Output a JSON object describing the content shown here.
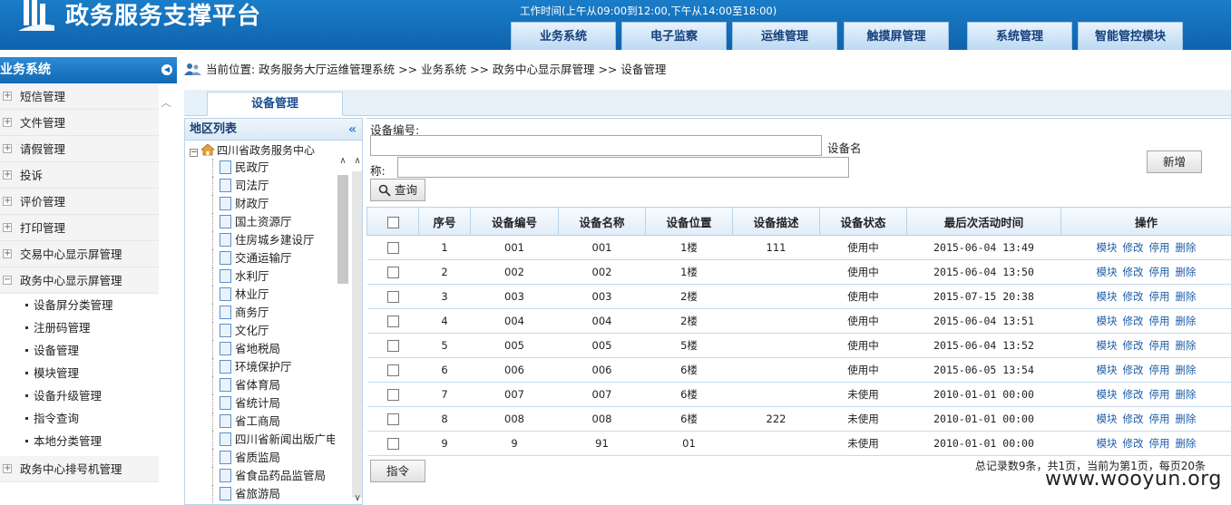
{
  "header": {
    "title": "政务服务支撑平台",
    "work_time": "工作时间(上午从09:00到12:00,下午从14:00至18:00)",
    "nav_tabs": [
      "业务系统",
      "电子监察",
      "运维管理",
      "触摸屏管理",
      "系统管理",
      "智能管控模块"
    ],
    "colors": {
      "header_bg": "#1269b5",
      "accent": "#1d5ea8"
    }
  },
  "sidebar": {
    "title": "业务系统",
    "items": [
      "短信管理",
      "文件管理",
      "请假管理",
      "投诉",
      "评价管理",
      "打印管理",
      "交易中心显示屏管理",
      "政务中心显示屏管理"
    ],
    "sub_items": [
      "设备屏分类管理",
      "注册码管理",
      "设备管理",
      "模块管理",
      "设备升级管理",
      "指令查询",
      "本地分类管理"
    ],
    "last_item": "政务中心排号机管理"
  },
  "breadcrumb": {
    "text": "当前位置: 政务服务大厅运维管理系统 >> 业务系统 >> 政务中心显示屏管理 >> 设备管理"
  },
  "content_tab": "设备管理",
  "region": {
    "title": "地区列表",
    "root": "四川省政务服务中心",
    "nodes": [
      "民政厅",
      "司法厅",
      "财政厅",
      "国土资源厅",
      "住房城乡建设厅",
      "交通运输厅",
      "水利厅",
      "林业厅",
      "商务厅",
      "文化厅",
      "省地税局",
      "环境保护厅",
      "省体育局",
      "省统计局",
      "省工商局",
      "四川省新闻出版广电",
      "省质监局",
      "省食品药品监管局",
      "省旅游局"
    ]
  },
  "form": {
    "device_no_label": "设备编号:",
    "device_no_value": "",
    "device_name_label_1": "设备名",
    "device_name_label_2": "称:",
    "device_name_value": "",
    "query_button": "查询",
    "add_button": "新增"
  },
  "table": {
    "headers": [
      "序号",
      "设备编号",
      "设备名称",
      "设备位置",
      "设备描述",
      "设备状态",
      "最后次活动时间",
      "操作"
    ],
    "actions": [
      "模块",
      "修改",
      "停用",
      "删除"
    ],
    "rows": [
      [
        "1",
        "001",
        "001",
        "1楼",
        "111",
        "使用中",
        "2015-06-04 13:49"
      ],
      [
        "2",
        "002",
        "002",
        "1楼",
        "",
        "使用中",
        "2015-06-04 13:50"
      ],
      [
        "3",
        "003",
        "003",
        "2楼",
        "",
        "使用中",
        "2015-07-15 20:38"
      ],
      [
        "4",
        "004",
        "004",
        "2楼",
        "",
        "使用中",
        "2015-06-04 13:51"
      ],
      [
        "5",
        "005",
        "005",
        "5楼",
        "",
        "使用中",
        "2015-06-04 13:52"
      ],
      [
        "6",
        "006",
        "006",
        "6楼",
        "",
        "使用中",
        "2015-06-05 13:54"
      ],
      [
        "7",
        "007",
        "007",
        "6楼",
        "",
        "未使用",
        "2010-01-01 00:00"
      ],
      [
        "8",
        "008",
        "008",
        "6楼",
        "222",
        "未使用",
        "2010-01-01 00:00"
      ],
      [
        "9",
        "9",
        "91",
        "01",
        "",
        "未使用",
        "2010-01-01 00:00"
      ]
    ]
  },
  "footer": {
    "command_button": "指令",
    "pager": "总记录数9条，共1页，当前为第1页，每页20条"
  },
  "watermark": "www.wooyun.org"
}
